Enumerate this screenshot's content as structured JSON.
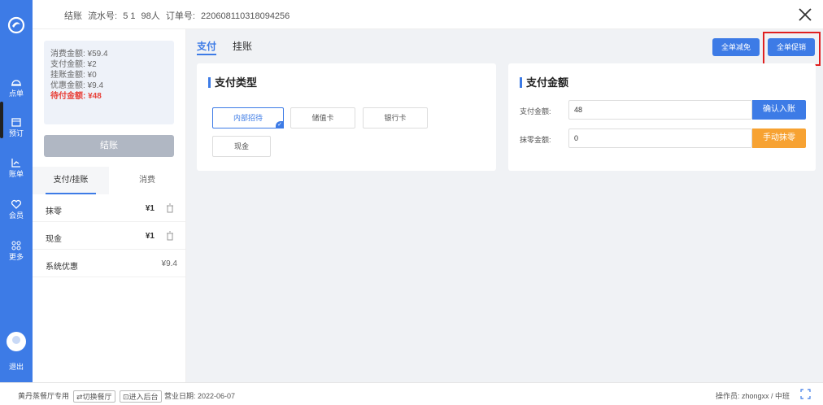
{
  "header": {
    "title": "结账",
    "serial_label": "流水号:",
    "serial_value": "5 1",
    "guests": "98人",
    "order_label": "订单号:",
    "order_value": "220608110318094256"
  },
  "nav": {
    "items": [
      {
        "label": "点单",
        "icon": "cloche-icon"
      },
      {
        "label": "预订",
        "icon": "calendar-icon"
      },
      {
        "label": "账单",
        "icon": "chart-icon"
      },
      {
        "label": "会员",
        "icon": "heart-icon"
      },
      {
        "label": "更多",
        "icon": "grid-icon"
      }
    ],
    "logout": "退出"
  },
  "summary": {
    "consume": "消费金额: ¥59.4",
    "paid": "支付金额: ¥2",
    "credit": "挂账金额: ¥0",
    "discount": "优惠金额: ¥9.4",
    "due": "待付金额: ¥48"
  },
  "checkout_label": "结账",
  "left_tabs": [
    "支付/挂账",
    "消费"
  ],
  "payments": [
    {
      "name": "抹零",
      "amount": "¥1"
    },
    {
      "name": "现金",
      "amount": "¥1"
    },
    {
      "name": "系统优惠",
      "amount": "¥9.4"
    }
  ],
  "main_tabs": [
    "支付",
    "挂账"
  ],
  "top_buttons": {
    "full_discount": "全单减免",
    "full_promo": "全单促销"
  },
  "pay_type": {
    "title": "支付类型",
    "options": [
      "内部招待",
      "储值卡",
      "银行卡",
      "现金"
    ],
    "selected": "内部招待"
  },
  "pay_amount": {
    "title": "支付金额",
    "amount_label": "支付金额:",
    "amount_value": "48",
    "confirm_button": "确认入账",
    "round_label": "抹零金额:",
    "round_value": "0",
    "round_button": "手动抹零"
  },
  "statusbar": {
    "restaurant": "黄丹蒸餐厅专用",
    "switch": "⇄切换餐厅",
    "backend": "⊡进入后台",
    "business_date": "营业日期: 2022-06-07",
    "operator": "操作员: zhongxx / 中班"
  },
  "colors": {
    "primary": "#3d7be6",
    "orange": "#f7a232",
    "danger": "#e8413a"
  }
}
